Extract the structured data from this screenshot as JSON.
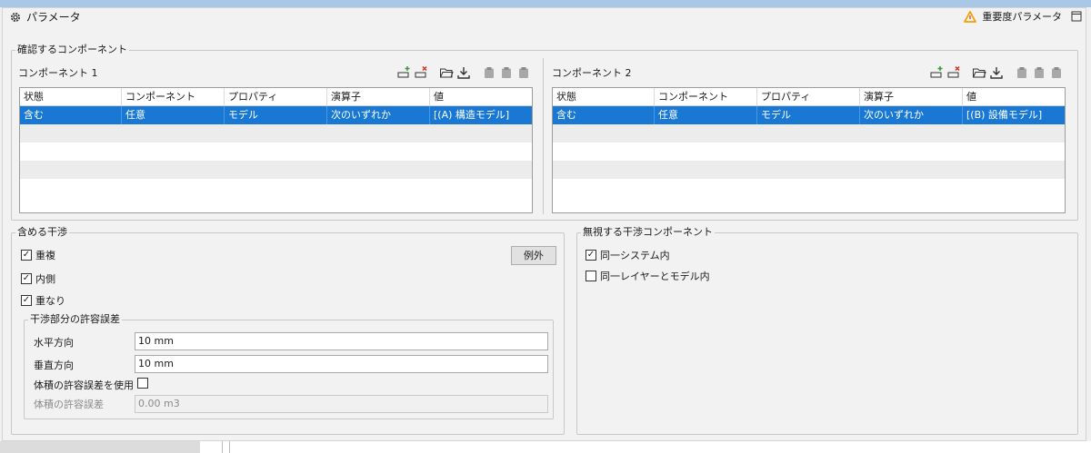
{
  "panel": {
    "title": "パラメータ",
    "priority_label": "重要度パラメータ"
  },
  "components": {
    "legend": "確認するコンポーネント",
    "left": {
      "label": "コンポーネント 1"
    },
    "right": {
      "label": "コンポーネント 2"
    },
    "columns": [
      "状態",
      "コンポーネント",
      "プロパティ",
      "演算子",
      "値"
    ],
    "left_rows": [
      [
        "含む",
        "任意",
        "モデル",
        "次のいずれか",
        "[(A) 構造モデル]"
      ]
    ],
    "right_rows": [
      [
        "含む",
        "任意",
        "モデル",
        "次のいずれか",
        "[(B) 設備モデル]"
      ]
    ]
  },
  "include": {
    "legend": "含める干渉",
    "duplicate": "重複",
    "inside": "内側",
    "overlap": "重なり",
    "exception_button": "例外",
    "tolerance": {
      "legend": "干渉部分の許容誤差",
      "horizontal_label": "水平方向",
      "horizontal_value": "10 mm",
      "vertical_label": "垂直方向",
      "vertical_value": "10 mm",
      "use_volume_label": "体積の許容誤差を使用",
      "volume_label": "体積の許容誤差",
      "volume_value": "0.00 m3"
    }
  },
  "ignore": {
    "legend": "無視する干渉コンポーネント",
    "same_system": "同一システム内",
    "same_layer_model": "同一レイヤーとモデル内"
  },
  "colors": {
    "selection": "#1978d4",
    "warning_icon": "#f5a000"
  }
}
